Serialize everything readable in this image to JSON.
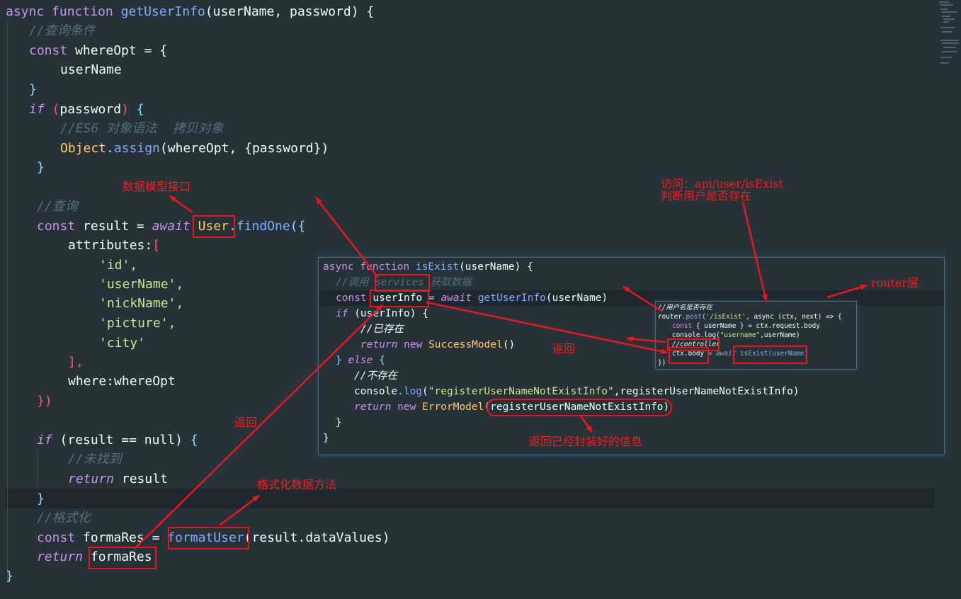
{
  "main_code": {
    "l1_kw1": "async",
    "l1_kw2": "function",
    "l1_fn": "getUserInfo",
    "l1_params": "(userName, password) {",
    "l2_comment": "//查询条件",
    "l3_kw": "const",
    "l3_rest": "whereOpt = {",
    "l4": "userName",
    "l5": "}",
    "l6_kw": "if",
    "l6_paren_open": "(",
    "l6_var": "password",
    "l6_paren_close": ")",
    "l6_brace": "{",
    "l7_comment": "//ES6 对象语法  拷贝对象",
    "l8_cls": "Object",
    "l8_dot": ".",
    "l8_fn": "assign",
    "l8_args": "(whereOpt, {password})",
    "l9": "}",
    "l11_comment": "//查询",
    "l12_kw": "const",
    "l12_var": "result =",
    "l12_await": "await",
    "l12_cls": "User",
    "l12_dot": ".",
    "l12_fn": "findOne",
    "l12_open": "({",
    "l13": "attributes:",
    "l13_br": "[",
    "l14": "'id',",
    "l15": "'userName',",
    "l16": "'nickName',",
    "l17": "'picture',",
    "l18": "'city'",
    "l19": "],",
    "l20": "where:whereOpt",
    "l21": "})",
    "l23_kw": "if",
    "l23_rest": "(result == null)",
    "l23_brace": "{",
    "l24_comment": "//未找到",
    "l25_kw": "return",
    "l25_var": "result",
    "l26": "}",
    "l27_comment": "//格式化",
    "l28_kw": "const",
    "l28_var": "formaRes =",
    "l28_fn": "formatUser",
    "l28_args": "(result.dataValues)",
    "l29_kw": "return",
    "l29_var": "formaRes",
    "l30": "}"
  },
  "panel_code": {
    "p1_kw1": "async",
    "p1_kw2": "function",
    "p1_fn": "isExist",
    "p1_rest": "(userName) {",
    "p2_comment": "//调用",
    "p2_services": "services",
    "p2_comment2": "获取数据",
    "p3_kw": "const",
    "p3_var": "userInfo",
    "p3_eq": "=",
    "p3_await": "await",
    "p3_fn": "getUserInfo",
    "p3_args": "(userName)",
    "p4_kw": "if",
    "p4_rest": "(userInfo) {",
    "p5_comment": "//已存在",
    "p6_kw": "return",
    "p6_new": "new",
    "p6_cls": "SuccessModel",
    "p6_paren": "()",
    "p7_brace": "}",
    "p7_kw": "else",
    "p7_rest": "{",
    "p8_comment": "//不存在",
    "p9_obj": "console",
    "p9_fn": "log",
    "p9_str": "\"registerUserNameNotExistInfo\"",
    "p9_rest": ",registerUserNameNotExistInfo)",
    "p10_kw": "return",
    "p10_new": "new",
    "p10_cls": "ErrorModel",
    "p10_arg": "(registerUserNameNotExistInfo)",
    "p11": "}",
    "p12": "}"
  },
  "mini_code": {
    "m1_comment": "//用户名是否存在",
    "m2_router": "router",
    "m2_fn": "post",
    "m2_str": "('/isExist'",
    "m2_rest": ", async (ctx, next) => {",
    "m3_kw": "const",
    "m3_rest": "{ userName } = ctx.request.body",
    "m4_rest": "console.log(",
    "m4_str": "\"username\"",
    "m4_rest2": ",userName)",
    "m5_comment": "//controller",
    "m6_var": "ctx.body",
    "m6_eq": "=",
    "m6_await": "await",
    "m6_fn": "isExist(userName)",
    "m7": "})"
  },
  "annotations": {
    "data_model_interface": "数据模型接口",
    "visit_api": "访问：api/user/isExist\n判断用户是否存在",
    "router_layer": "router层",
    "return_1": "返回",
    "return_2": "返回",
    "formatter_method": "格式化数据方法",
    "return_wrapped_info": "返回已经封装好的信息"
  },
  "colors": {
    "background": "#263238",
    "annotation_red": "#e8171f",
    "keyword": "#c792ea",
    "function": "#82aaff",
    "string": "#c3e88d",
    "comment": "#546e7a"
  }
}
